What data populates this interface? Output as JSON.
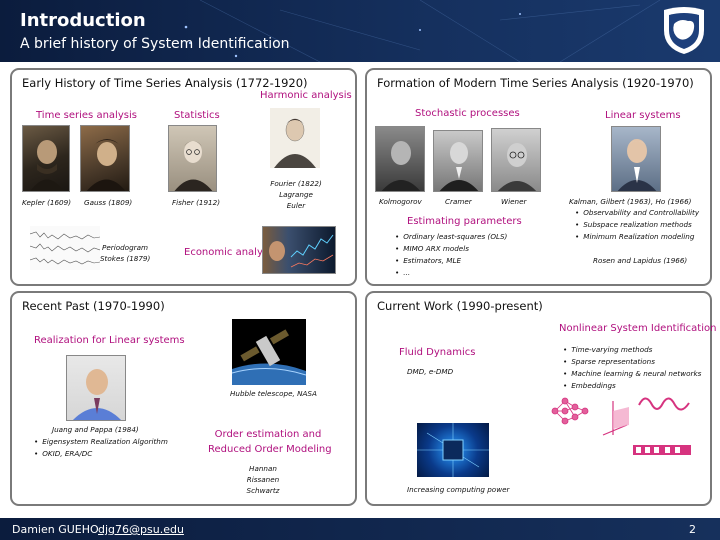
{
  "header": {
    "title": "Introduction",
    "subtitle": "A brief history of System Identification"
  },
  "footer": {
    "author": "Damien GUEHO",
    "email": "djg76@psu.edu",
    "page": "2"
  },
  "panels": {
    "early": {
      "title": "Early History of Time Series Analysis (1772-1920)",
      "time_series_heading": "Time series analysis",
      "statistics_heading": "Statistics",
      "harmonic_heading": "Harmonic analysis",
      "kepler": "Kepler (1609)",
      "gauss": "Gauss (1809)",
      "fisher": "Fisher (1912)",
      "harmonic_people": [
        "Fourier (1822)",
        "Lagrange",
        "Euler"
      ],
      "periodogram": [
        "Periodogram",
        "Stokes (1879)"
      ],
      "economic_heading": "Economic analysis"
    },
    "modern": {
      "title": "Formation of Modern Time Series Analysis (1920-1970)",
      "stochastic_heading": "Stochastic processes",
      "linear_heading": "Linear systems",
      "kolmogorov": "Kolmogorov",
      "cramer": "Cramer",
      "wiener": "Wiener",
      "estimating_heading": "Estimating parameters",
      "estimating_items": [
        "Ordinary least-squares (OLS)",
        "MIMO ARX models",
        "Estimators, MLE",
        "..."
      ],
      "linear_caption": "Kalman, Gilbert (1963), Ho (1966)",
      "linear_items": [
        "Observability and Controllability",
        "Subspace realization methods",
        "Minimum Realization modeling"
      ],
      "rosen": "Rosen and Lapidus (1966)"
    },
    "recent": {
      "title": "Recent Past (1970-1990)",
      "realization_heading": "Realization for Linear systems",
      "juang": "Juang and Pappa (1984)",
      "juang_items": [
        "Eigensystem Realization Algorithm",
        "OKID, ERA/DC"
      ],
      "hubble": "Hubble telescope, NASA",
      "order_heading": [
        "Order estimation and",
        "Reduced Order Modeling"
      ],
      "order_people": [
        "Hannan",
        "Rissanen",
        "Schwartz"
      ]
    },
    "current": {
      "title": "Current Work (1990-present)",
      "fluid_heading": "Fluid Dynamics",
      "fluid_text": "DMD, e-DMD",
      "nonlinear_heading": "Nonlinear System Identification",
      "nonlinear_items": [
        "Time-varying methods",
        "Sparse representations",
        "Machine learning & neural networks",
        "Embeddings"
      ],
      "computing": "Increasing computing power"
    }
  }
}
